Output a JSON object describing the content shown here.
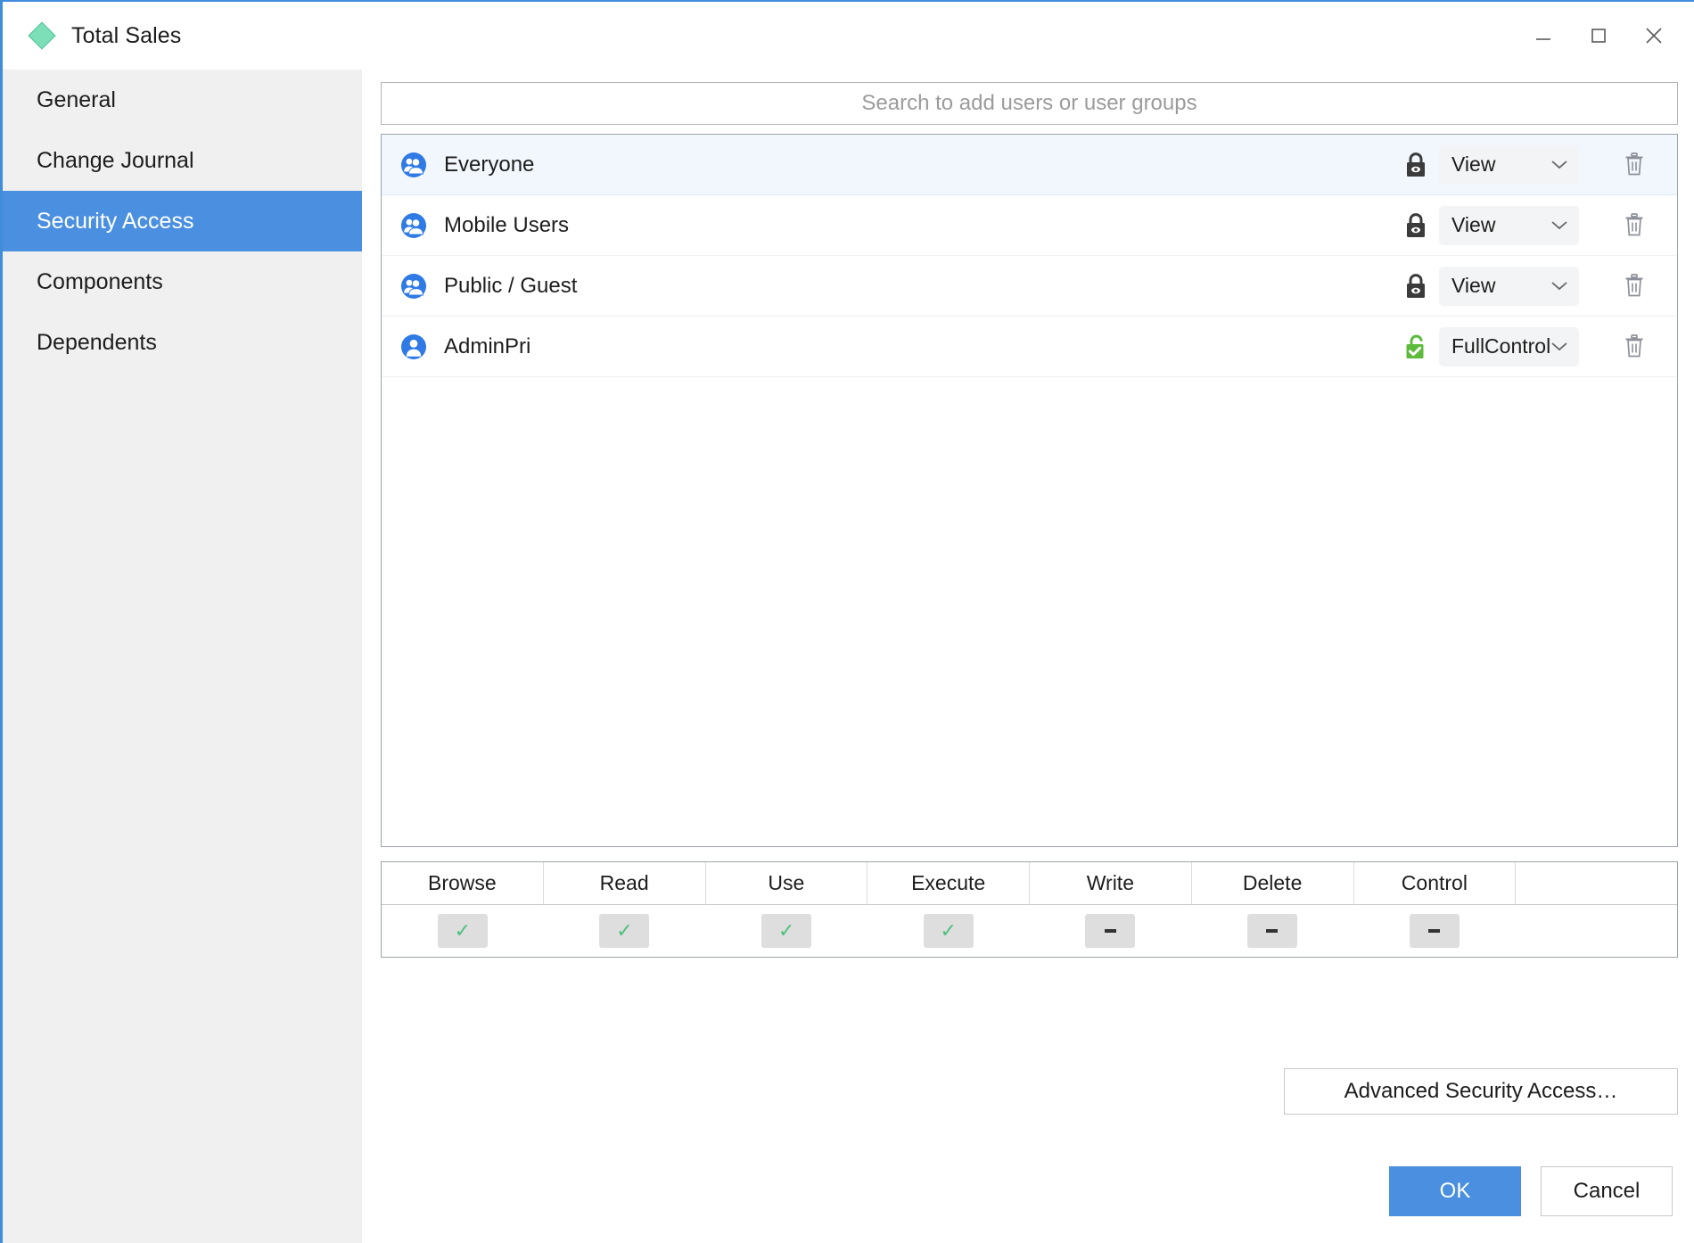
{
  "window": {
    "title": "Total Sales",
    "app_icon": "diamond-icon",
    "accent_color": "#4a8fe0",
    "icon_color": "#7ddfb8",
    "controls": {
      "minimize": "minimize-icon",
      "maximize": "maximize-icon",
      "close": "close-icon"
    }
  },
  "sidebar": {
    "items": [
      {
        "label": "General",
        "active": false
      },
      {
        "label": "Change Journal",
        "active": false
      },
      {
        "label": "Security Access",
        "active": true
      },
      {
        "label": "Components",
        "active": false
      },
      {
        "label": "Dependents",
        "active": false
      }
    ]
  },
  "search": {
    "placeholder": "Search to add users or user groups",
    "value": ""
  },
  "access_list": {
    "rows": [
      {
        "name": "Everyone",
        "icon": "user-group-icon",
        "lock": "locked-view-icon",
        "lock_state": "locked",
        "permission": "View",
        "delete": "trash-icon",
        "selected": true
      },
      {
        "name": "Mobile Users",
        "icon": "user-group-icon",
        "lock": "locked-view-icon",
        "lock_state": "locked",
        "permission": "View",
        "delete": "trash-icon",
        "selected": false
      },
      {
        "name": "Public / Guest",
        "icon": "user-group-icon",
        "lock": "locked-view-icon",
        "lock_state": "locked",
        "permission": "View",
        "delete": "trash-icon",
        "selected": false
      },
      {
        "name": "AdminPri",
        "icon": "user-single-icon",
        "lock": "unlocked-check-icon",
        "lock_state": "unlocked",
        "permission": "FullControl",
        "delete": "trash-icon",
        "selected": false
      }
    ]
  },
  "permission_table": {
    "columns": [
      "Browse",
      "Read",
      "Use",
      "Execute",
      "Write",
      "Delete",
      "Control",
      ""
    ],
    "values": [
      "check",
      "check",
      "check",
      "check",
      "dash",
      "dash",
      "dash",
      ""
    ],
    "check_color": "#4ec07e",
    "badge_color": "#dedede"
  },
  "buttons": {
    "advanced": "Advanced Security Access…",
    "ok": "OK",
    "cancel": "Cancel"
  }
}
